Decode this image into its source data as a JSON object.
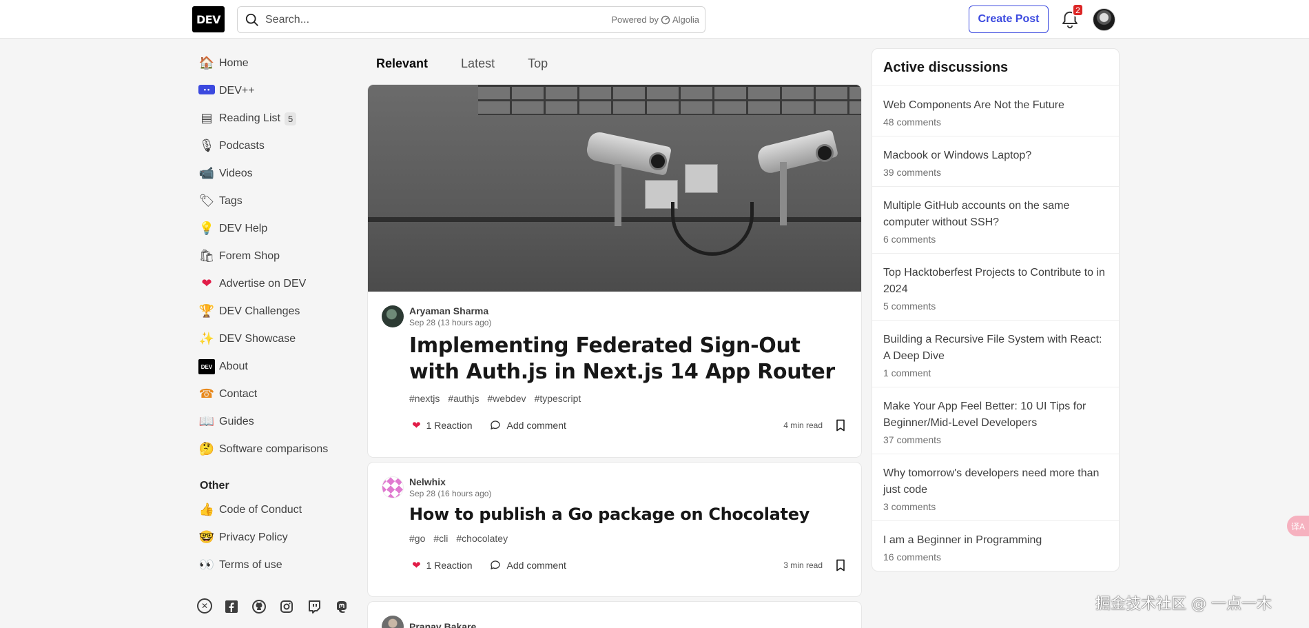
{
  "header": {
    "logo": "DEV",
    "search_placeholder": "Search...",
    "powered_by": "Powered by",
    "algolia": "Algolia",
    "create_post": "Create Post",
    "notification_count": "2"
  },
  "sidebar": {
    "items": [
      {
        "icon": "house-icon",
        "glyph": "🏠",
        "label": "Home"
      },
      {
        "icon": "dev-plus-icon",
        "glyph": "••",
        "label": "DEV++"
      },
      {
        "icon": "reading-list-icon",
        "glyph": "▤",
        "label": "Reading List",
        "count": "5"
      },
      {
        "icon": "microphone-icon",
        "glyph": "🎙",
        "label": "Podcasts"
      },
      {
        "icon": "video-camera-icon",
        "glyph": "📹",
        "label": "Videos"
      },
      {
        "icon": "tag-icon",
        "glyph": "🏷",
        "label": "Tags"
      },
      {
        "icon": "lightbulb-icon",
        "glyph": "💡",
        "label": "DEV Help"
      },
      {
        "icon": "shopping-bags-icon",
        "glyph": "🛍",
        "label": "Forem Shop"
      },
      {
        "icon": "heart-icon",
        "glyph": "❤",
        "label": "Advertise on DEV"
      },
      {
        "icon": "trophy-icon",
        "glyph": "🏆",
        "label": "DEV Challenges"
      },
      {
        "icon": "sparkles-icon",
        "glyph": "✨",
        "label": "DEV Showcase"
      },
      {
        "icon": "dev-logo-icon",
        "glyph": "DEV",
        "label": "About"
      },
      {
        "icon": "contact-icon",
        "glyph": "☎",
        "label": "Contact"
      },
      {
        "icon": "book-icon",
        "glyph": "📖",
        "label": "Guides"
      },
      {
        "icon": "thinking-face-icon",
        "glyph": "🤔",
        "label": "Software comparisons"
      }
    ],
    "other_heading": "Other",
    "other_items": [
      {
        "icon": "thumbs-up-icon",
        "glyph": "👍",
        "label": "Code of Conduct"
      },
      {
        "icon": "nerd-face-icon",
        "glyph": "🤓",
        "label": "Privacy Policy"
      },
      {
        "icon": "eyes-icon",
        "glyph": "👀",
        "label": "Terms of use"
      }
    ],
    "social": [
      "x-icon",
      "facebook-icon",
      "github-icon",
      "instagram-icon",
      "twitch-icon",
      "mastodon-icon"
    ]
  },
  "feed": {
    "tabs": [
      "Relevant",
      "Latest",
      "Top"
    ],
    "active_tab": "Relevant",
    "posts": [
      {
        "author": "Aryaman Sharma",
        "date": "Sep 28 (13 hours ago)",
        "title": "Implementing Federated Sign-Out with Auth.js in Next.js 14 App Router",
        "tags": [
          "#nextjs",
          "#authjs",
          "#webdev",
          "#typescript"
        ],
        "reactions": "1 Reaction",
        "comment_label": "Add comment",
        "read_time": "4 min read"
      },
      {
        "author": "Nelwhix",
        "date": "Sep 28 (16 hours ago)",
        "title": "How to publish a Go package on Chocolatey",
        "tags": [
          "#go",
          "#cli",
          "#chocolatey"
        ],
        "reactions": "1 Reaction",
        "comment_label": "Add comment",
        "read_time": "3 min read"
      },
      {
        "author": "Pranav Bakare"
      }
    ]
  },
  "discussions": {
    "heading": "Active discussions",
    "items": [
      {
        "title": "Web Components Are Not the Future",
        "comments": "48 comments"
      },
      {
        "title": "Macbook or Windows Laptop?",
        "comments": "39 comments"
      },
      {
        "title": "Multiple GitHub accounts on the same computer without SSH?",
        "comments": "6 comments"
      },
      {
        "title": "Top Hacktoberfest Projects to Contribute to in 2024",
        "comments": "5 comments"
      },
      {
        "title": "Building a Recursive File System with React: A Deep Dive",
        "comments": "1 comment"
      },
      {
        "title": "Make Your App Feel Better: 10 UI Tips for Beginner/Mid-Level Developers",
        "comments": "37 comments"
      },
      {
        "title": "Why tomorrow's developers need more than just code",
        "comments": "3 comments"
      },
      {
        "title": "I am a Beginner in Programming",
        "comments": "16 comments"
      }
    ]
  },
  "watermark": "掘金技术社区 @ 一点一木",
  "translate_button": "译A",
  "colors": {
    "accent": "#3b49df",
    "badge": "#dc2626",
    "heart": "#e11d48"
  }
}
